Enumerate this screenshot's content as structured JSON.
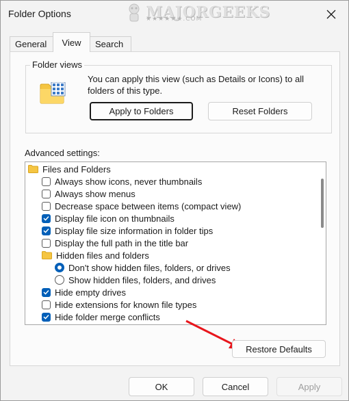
{
  "window": {
    "title": "Folder Options"
  },
  "watermark": {
    "text": "MAJORGEEKS",
    "sub": "★★★★★★.COM"
  },
  "tabs": [
    {
      "label": "General"
    },
    {
      "label": "View"
    },
    {
      "label": "Search"
    }
  ],
  "folder_views": {
    "legend": "Folder views",
    "description": "You can apply this view (such as Details or Icons) to all folders of this type.",
    "apply_label": "Apply to Folders",
    "reset_label": "Reset Folders"
  },
  "advanced": {
    "label": "Advanced settings:",
    "items": [
      {
        "type": "folder",
        "label": "Files and Folders"
      },
      {
        "type": "checkbox",
        "label": "Always show icons, never thumbnails",
        "checked": false
      },
      {
        "type": "checkbox",
        "label": "Always show menus",
        "checked": false
      },
      {
        "type": "checkbox",
        "label": "Decrease space between items (compact view)",
        "checked": false
      },
      {
        "type": "checkbox",
        "label": "Display file icon on thumbnails",
        "checked": true
      },
      {
        "type": "checkbox",
        "label": "Display file size information in folder tips",
        "checked": true
      },
      {
        "type": "checkbox",
        "label": "Display the full path in the title bar",
        "checked": false
      },
      {
        "type": "folder",
        "label": "Hidden files and folders"
      },
      {
        "type": "radio",
        "label": "Don't show hidden files, folders, or drives",
        "checked": true
      },
      {
        "type": "radio",
        "label": "Show hidden files, folders, and drives",
        "checked": false
      },
      {
        "type": "checkbox",
        "label": "Hide empty drives",
        "checked": true
      },
      {
        "type": "checkbox",
        "label": "Hide extensions for known file types",
        "checked": false
      },
      {
        "type": "checkbox",
        "label": "Hide folder merge conflicts",
        "checked": true
      }
    ],
    "restore_label": "Restore Defaults"
  },
  "footer": {
    "ok": "OK",
    "cancel": "Cancel",
    "apply": "Apply"
  },
  "colors": {
    "accent": "#005fb8",
    "annotation_arrow": "#e8161c",
    "folder": "#f5c542"
  }
}
